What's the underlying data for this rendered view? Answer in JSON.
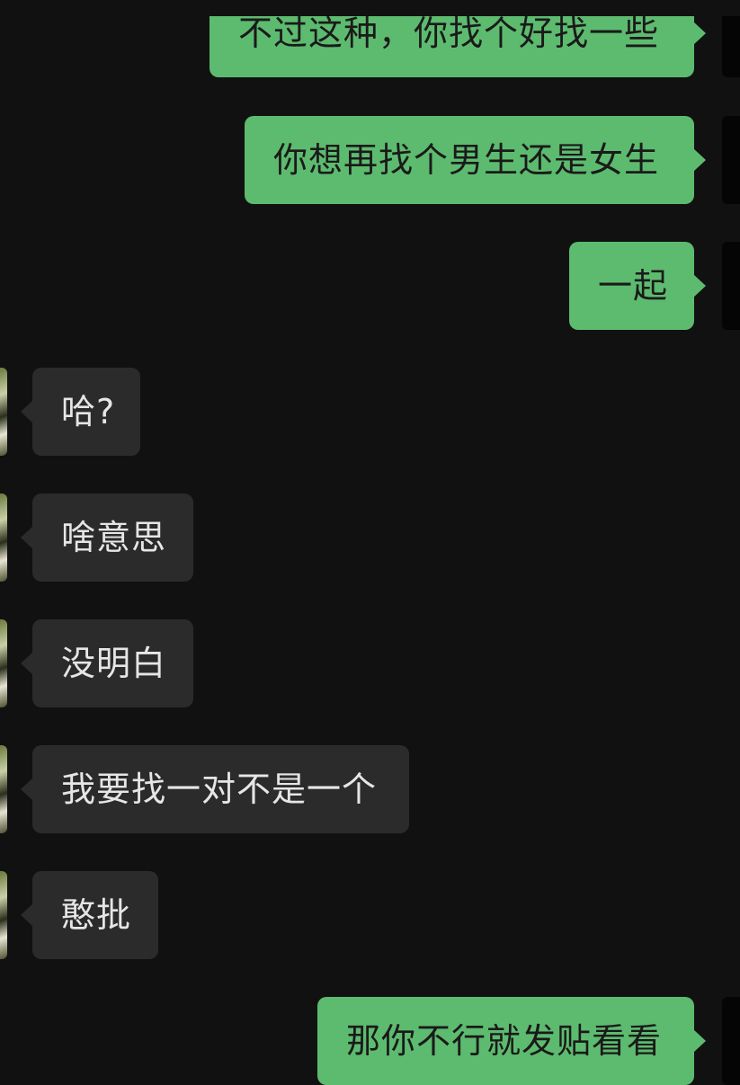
{
  "chat": {
    "messages": [
      {
        "direction": "out",
        "text": "不过这种，你找个好找一些"
      },
      {
        "direction": "out",
        "text": "你想再找个男生还是女生"
      },
      {
        "direction": "out",
        "text": "一起"
      },
      {
        "direction": "in",
        "text": "哈?"
      },
      {
        "direction": "in",
        "text": "啥意思"
      },
      {
        "direction": "in",
        "text": "没明白"
      },
      {
        "direction": "in",
        "text": "我要找一对不是一个"
      },
      {
        "direction": "in",
        "text": "憨批"
      },
      {
        "direction": "out",
        "text": "那你不行就发贴看看"
      }
    ]
  },
  "colors": {
    "background": "#111111",
    "outgoing_bubble": "#5dbb6f",
    "incoming_bubble": "#2b2b2b",
    "incoming_text": "#e6e6e6",
    "outgoing_text": "#1a1a1a"
  }
}
